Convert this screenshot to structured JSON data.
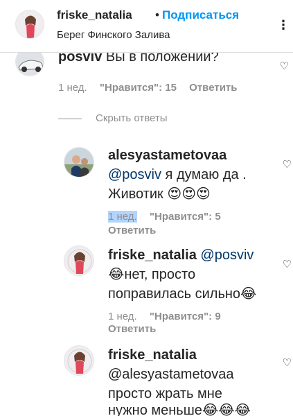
{
  "header": {
    "username": "friske_natalia",
    "separator": "•",
    "follow_label": "Подписаться",
    "location": "Берег Финского Залива",
    "more_icon": "⋮"
  },
  "comments": [
    {
      "author": "posviv",
      "text": "Вы в положении?",
      "time": "1 нед.",
      "likes": "\"Нравится\": 15",
      "reply": "Ответить"
    }
  ],
  "hide_replies": "Скрыть ответы",
  "replies": [
    {
      "author": "alesyastametovaa",
      "mention": "@posviv",
      "text_line1": " я думаю да .",
      "text_line2": "Животик 😍😍😍",
      "time": "1 нед.",
      "likes": "\"Нравится\": 5",
      "reply": "Ответить"
    },
    {
      "author": "friske_natalia",
      "mention": "@posviv",
      "text_line1": "😂нет, просто",
      "text_line2": "поправилась сильно😂",
      "time": "1 нед.",
      "likes": "\"Нравится\": 9",
      "reply": "Ответить"
    },
    {
      "author": "friske_natalia",
      "mention": "@alesyastametovaa",
      "text_line1": "просто жрать мне",
      "text_line2": "нужно меньше😂😂😂",
      "time": "",
      "likes": "",
      "reply": ""
    }
  ],
  "icons": {
    "heart": "♡"
  },
  "colors": {
    "follow_blue": "#0095f6",
    "mention_blue": "#00376b",
    "meta_gray": "#8e8e8e",
    "highlight": "#b3d4fc"
  }
}
